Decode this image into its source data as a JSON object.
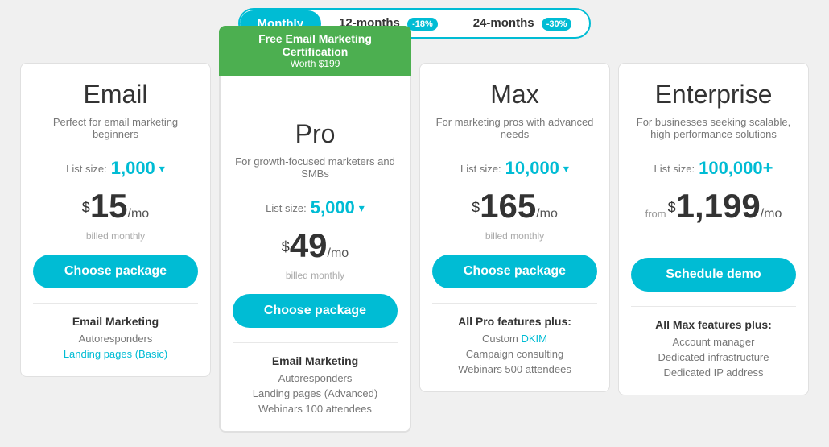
{
  "billing": {
    "options": [
      {
        "id": "monthly",
        "label": "Monthly",
        "active": true,
        "badge": null
      },
      {
        "id": "12months",
        "label": "12-months",
        "active": false,
        "badge": "-18%"
      },
      {
        "id": "24months",
        "label": "24-months",
        "active": false,
        "badge": "-30%"
      }
    ]
  },
  "plans": [
    {
      "id": "email",
      "name": "Email",
      "desc": "Perfect for email marketing beginners",
      "listSizeLabel": "List size:",
      "listSize": "1,000",
      "pricePrefix": null,
      "priceSup": "$",
      "priceMain": "15",
      "pricePer": "/mo",
      "billedNote": "billed monthly",
      "ctaLabel": "Choose package",
      "featured": false,
      "promo": null,
      "featureHeading": "Email Marketing",
      "features": [
        {
          "label": "Autoresponders",
          "link": false
        },
        {
          "label": "Landing pages (Basic)",
          "link": true
        }
      ]
    },
    {
      "id": "pro",
      "name": "Pro",
      "desc": "For growth-focused marketers and SMBs",
      "listSizeLabel": "List size:",
      "listSize": "5,000",
      "pricePrefix": null,
      "priceSup": "$",
      "priceMain": "49",
      "pricePer": "/mo",
      "billedNote": "billed monthly",
      "ctaLabel": "Choose package",
      "featured": true,
      "promo": {
        "title": "Free Email Marketing Certification",
        "sub": "Worth $199"
      },
      "featureHeading": "Email Marketing",
      "features": [
        {
          "label": "Autoresponders",
          "link": false
        },
        {
          "label": "Landing pages (Advanced)",
          "link": false
        },
        {
          "label": "Webinars 100 attendees",
          "link": false
        }
      ]
    },
    {
      "id": "max",
      "name": "Max",
      "desc": "For marketing pros with advanced needs",
      "listSizeLabel": "List size:",
      "listSize": "10,000",
      "pricePrefix": null,
      "priceSup": "$",
      "priceMain": "165",
      "pricePer": "/mo",
      "billedNote": "billed monthly",
      "ctaLabel": "Choose package",
      "featured": false,
      "promo": null,
      "featureHeading": "All Pro features plus:",
      "features": [
        {
          "label": "Custom DKIM",
          "link": false,
          "dkim": true
        },
        {
          "label": "Campaign consulting",
          "link": false
        },
        {
          "label": "Webinars 500 attendees",
          "link": false
        }
      ]
    },
    {
      "id": "enterprise",
      "name": "Enterprise",
      "desc": "For businesses seeking scalable, high-performance solutions",
      "listSizeLabel": "List size:",
      "listSize": "100,000+",
      "pricePrefix": "from",
      "priceSup": "$",
      "priceMain": "1,199",
      "pricePer": "/mo",
      "billedNote": null,
      "ctaLabel": "Schedule demo",
      "featured": false,
      "promo": null,
      "featureHeading": "All Max features plus:",
      "features": [
        {
          "label": "Account manager",
          "link": false
        },
        {
          "label": "Dedicated infrastructure",
          "link": false
        },
        {
          "label": "Dedicated IP address",
          "link": false
        }
      ]
    }
  ]
}
